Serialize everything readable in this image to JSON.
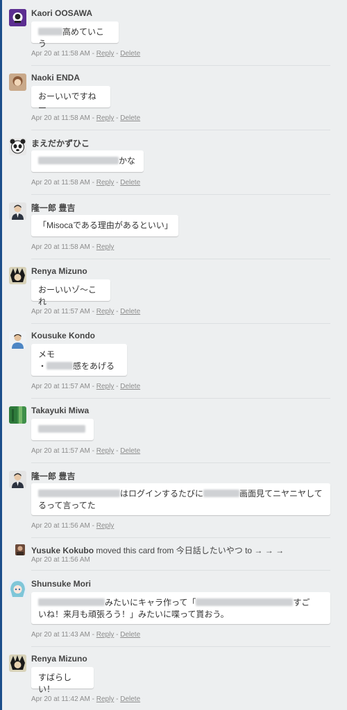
{
  "comments": [
    {
      "author": "Kaori OOSAWA",
      "avatar": "avatar-kaori",
      "text": "高めていこう",
      "time": "Apr 20 at 11:58 AM",
      "reply": "Reply",
      "delete": "Delete"
    },
    {
      "author": "Naoki ENDA",
      "avatar": "avatar-naoki",
      "text": "おーいいですねー",
      "time": "Apr 20 at 11:58 AM",
      "reply": "Reply",
      "delete": "Delete"
    },
    {
      "author": "まえだかずひこ",
      "avatar": "avatar-panda",
      "text": "かな",
      "time": "Apr 20 at 11:58 AM",
      "reply": "Reply",
      "delete": "Delete"
    },
    {
      "author": "隆一郎 豊吉",
      "avatar": "avatar-ryuichiro",
      "text": "「Misocaである理由があるといい」",
      "time": "Apr 20 at 11:58 AM",
      "reply": "Reply"
    },
    {
      "author": "Renya Mizuno",
      "avatar": "avatar-renya",
      "text": "おーいいゾ〜これ",
      "time": "Apr 20 at 11:57 AM",
      "reply": "Reply",
      "delete": "Delete"
    },
    {
      "author": "Kousuke Kondo",
      "avatar": "avatar-kousuke",
      "text_line1": "メモ",
      "text_line2_prefix": "・",
      "text_line2": "感をあげる",
      "time": "Apr 20 at 11:57 AM",
      "reply": "Reply",
      "delete": "Delete"
    },
    {
      "author": "Takayuki Miwa",
      "avatar": "avatar-takayuki",
      "time": "Apr 20 at 11:57 AM",
      "reply": "Reply",
      "delete": "Delete"
    },
    {
      "author": "隆一郎 豊吉",
      "avatar": "avatar-ryuichiro",
      "text_part1": "はログインするたびに",
      "text_part2": "画面見てニヤニヤして",
      "text_line2": "るって言ってた",
      "time": "Apr 20 at 11:56 AM",
      "reply": "Reply"
    },
    {
      "author": "Shunsuke Mori",
      "avatar": "avatar-shunsuke",
      "text_part1": "みたいにキャラ作って「",
      "text_part2": "すご",
      "text_line2": "いね！来月も頑張ろう！」みたいに喋って貰おう。",
      "time": "Apr 20 at 11:43 AM",
      "reply": "Reply",
      "delete": "Delete"
    },
    {
      "author": "Renya Mizuno",
      "avatar": "avatar-renya",
      "text": "すばらしい！",
      "time": "Apr 20 at 11:42 AM",
      "reply": "Reply",
      "delete": "Delete"
    }
  ],
  "activity": {
    "author": "Yusuke Kokubo",
    "text": "moved this card from 今日話したいやつ to → → →",
    "time": "Apr 20 at 11:56 AM"
  },
  "separators": {
    "dash": " - "
  }
}
